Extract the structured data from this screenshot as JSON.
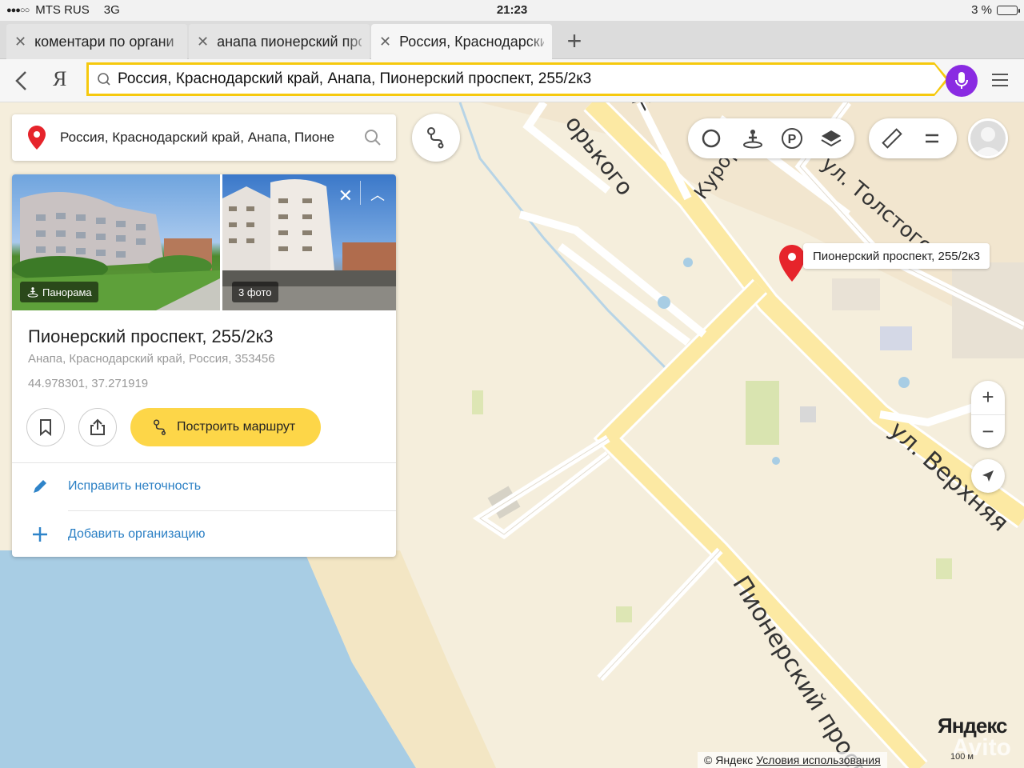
{
  "status": {
    "carrier": "MTS RUS",
    "network": "3G",
    "time": "21:23",
    "battery": "3 %"
  },
  "tabs": [
    {
      "title": "коментари по органи"
    },
    {
      "title": "анапа пионерский про"
    },
    {
      "title": "Россия, Краснодарски"
    }
  ],
  "browser": {
    "logo_letter": "Я",
    "url": "Россия, Краснодарский край, Анапа, Пионерский проспект, 255/2к3"
  },
  "map": {
    "search_query": "Россия, Краснодарский край, Анапа, Пионе",
    "card": {
      "panorama_label": "Панорама",
      "photos_label": "3 фото",
      "title": "Пионерский проспект, 255/2к3",
      "address": "Анапа, Краснодарский край, Россия, 353456",
      "coordinates": "44.978301, 37.271919",
      "route_label": "Построить маршрут",
      "fix_label": "Исправить неточность",
      "add_org_label": "Добавить организацию"
    },
    "marker_label": "Пионерский проспект, 255/2к3",
    "streets": {
      "gorkogo": "орького",
      "kurortny": "Курорт",
      "tolstogo": "ул. Толстого",
      "verkhnyaya": "ул. Верхняя",
      "pionersky": "Пионерский просп",
      "zh": "Ж"
    },
    "logo": "Яндекс",
    "scale": "100 м",
    "copyright": "© Яндекс",
    "terms": "Условия использования",
    "watermark": "Avito",
    "zoom_in": "+",
    "zoom_out": "−"
  },
  "colors": {
    "accent_yellow": "#fdd648",
    "omnibox_border": "#f6c90e",
    "mic_purple": "#8a2be2",
    "link_blue": "#2a7fc4",
    "marker_red": "#e6242b",
    "sea": "#a8cde4",
    "land": "#f5eedc",
    "road": "#fce9a3"
  }
}
